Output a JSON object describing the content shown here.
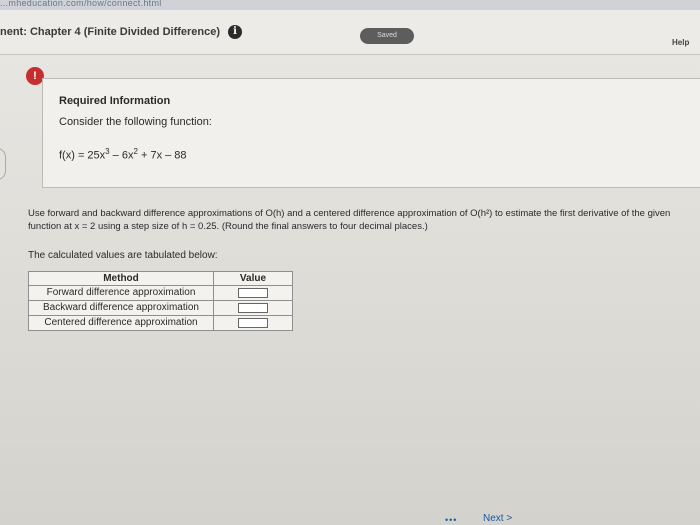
{
  "browser": {
    "url": "...mheducation.com/how/connect.html"
  },
  "header": {
    "assignment_title": "nent: Chapter 4 (Finite Divided Difference)",
    "info_icon": "i",
    "saved_label": "Saved",
    "help_label": "Help"
  },
  "alert_icon": "!",
  "info_box": {
    "title": "Required Information",
    "prompt": "Consider the following function:",
    "function": {
      "lhs": "f(x) = 25x",
      "exp1": "3",
      "mid": " – 6x",
      "exp2": "2",
      "rest": " + 7x – 88"
    }
  },
  "question": {
    "text": "Use forward and backward difference approximations of O(h) and a centered difference approximation of O(h²) to estimate the first derivative of the given function at x = 2 using a step size of h = 0.25. (Round the final answers to four decimal places.)"
  },
  "table_intro": "The calculated values are tabulated below:",
  "table": {
    "headers": [
      "Method",
      "Value"
    ],
    "rows": [
      {
        "method": "Forward difference approximation",
        "value": ""
      },
      {
        "method": "Backward difference approximation",
        "value": ""
      },
      {
        "method": "Centered difference approximation",
        "value": ""
      }
    ]
  },
  "footer": {
    "dots": "•••",
    "next_label": "Next >"
  },
  "colors": {
    "alert": "#c62f2f",
    "link": "#1a5aa0",
    "saved_badge": "#5d5d5d"
  }
}
